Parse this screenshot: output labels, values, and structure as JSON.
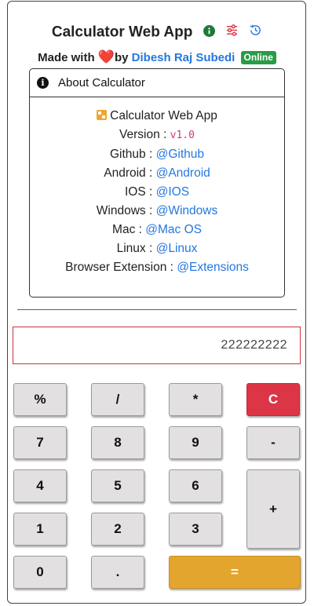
{
  "header": {
    "title": "Calculator Web App",
    "made_with": "Made with",
    "by": "by",
    "author": "Dibesh Raj Subedi",
    "status_badge": "Online",
    "icons": [
      "info-icon",
      "settings-sliders-icon",
      "history-clock-icon",
      "heart-icon"
    ]
  },
  "about": {
    "heading": "About Calculator",
    "app_name": "Calculator Web App",
    "version_label": "Version :",
    "version": "v1.0",
    "links": [
      {
        "label": "Github :",
        "link": "@Github"
      },
      {
        "label": "Android :",
        "link": "@Android"
      },
      {
        "label": "IOS :",
        "link": "@IOS"
      },
      {
        "label": "Windows :",
        "link": "@Windows"
      },
      {
        "label": "Mac :",
        "link": "@Mac OS"
      },
      {
        "label": "Linux :",
        "link": "@Linux"
      },
      {
        "label": "Browser Extension :",
        "link": "@Extensions"
      }
    ]
  },
  "display": {
    "value": "222222222"
  },
  "keys": {
    "percent": "%",
    "divide": "/",
    "multiply": "*",
    "clear": "C",
    "seven": "7",
    "eight": "8",
    "nine": "9",
    "minus": "-",
    "four": "4",
    "five": "5",
    "six": "6",
    "plus": "+",
    "one": "1",
    "two": "2",
    "three": "3",
    "zero": "0",
    "dot": ".",
    "equals": "="
  },
  "colors": {
    "clear": "#dc3545",
    "equals": "#e4a52e",
    "link": "#2477e0",
    "badge": "#2a9b46",
    "display_border": "#c8323f"
  }
}
